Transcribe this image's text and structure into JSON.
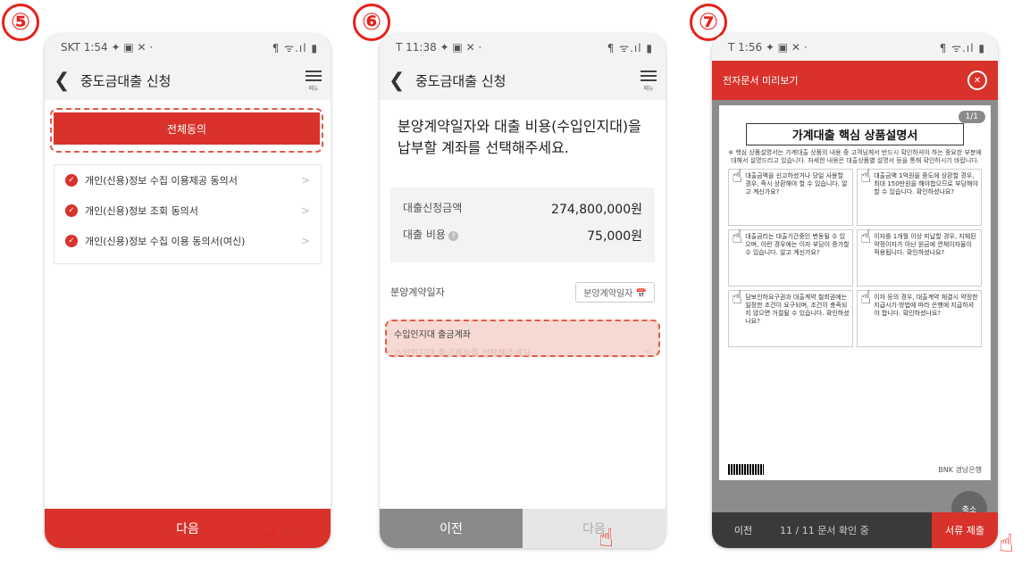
{
  "steps": {
    "s5": "⑤",
    "s6": "⑥",
    "s7": "⑦"
  },
  "phone5": {
    "status_left": "SKT 1:54 ✦ ▣ ✕ ·",
    "status_right": "¶ ᯤ.ıl ▮",
    "title": "중도금대출 신청",
    "menu_label": "메뉴",
    "agree_all": "전체동의",
    "consents": [
      "개인(신용)정보 수집 이용제공 동의서",
      "개인(신용)정보 조회 동의서",
      "개인(신용)정보 수집 이용 동의서(여신)"
    ],
    "next": "다음"
  },
  "phone6": {
    "status_left": "T 11:38 ✦ ▣ ✕ ·",
    "status_right": "¶ ᯤ.ıl ▮",
    "title": "중도금대출 신청",
    "menu_label": "메뉴",
    "heading": "분양계약일자와 대출 비용(수입인지대)을 납부할 계좌를 선택해주세요.",
    "loan_amount_label": "대출신청금액",
    "loan_amount": "274,800,000원",
    "loan_cost_label": "대출 비용",
    "loan_cost": "75,000원",
    "contract_date_label": "분양계약일자",
    "contract_date_button": "분양계약일자 📅",
    "account_label": "수입인지대 출금계좌",
    "account_placeholder": "수입인지대 출금계좌를 선택해주세요",
    "prev": "이전",
    "next": "다음"
  },
  "phone7": {
    "status_left": "T 1:56 ✦ ▣ ✕ ·",
    "status_right": "¶ ᯤ.ıl ▮",
    "header": "전자문서 미리보기",
    "pager": "1/1",
    "doc_title": "가계대출 핵심 상품설명서",
    "doc_intro": "※ 핵심 상품설명서는 가계대출 상품의 내용 중 고객님께서 반드시 확인하셔야 하는 중요한 부분에 대해서 설명드리고 있습니다. 자세한 내용은 대출상품별 설명서 등을 통해 확인하시기 바랍니다.",
    "cells": [
      "대출금액을 신고하셨거나 당일 사용할 경우, 즉시 상환해야 할 수 있습니다. 알고 계신가요?",
      "대출금액 1억원을 중도에 상환할 경우, 최대 150만원을 해야합으므로 부담해야 할 수 있습니다. 확인하셨나요?",
      "대출금리는 대출기간중인 변동될 수 있으며, 이런 경우에는 이자 부담이 증가할 수 있습니다. 알고 계신가요?",
      "이자를 1개월 이상 미납할 경우, 지체된 약정이자가 아닌 원금에 연체이자율이 적용됩니다. 확인하셨나요?",
      "담보인하요구권과 대출계약 철회권에는 일정한 조건이 요구되며, 조건이 충족되지 않으면 거절될 수 있습니다. 확인하셨나요?",
      "이자 등의 경우, 대출계약 체결시 약정한 지급시기·방법에 따라 은행에 지급하셔야 합니다. 확인하셨나요?"
    ],
    "footer_brand": "BNK 경남은행",
    "zoom": "축소",
    "prev": "이전",
    "page_status": "11 / 11 문서 확인 중",
    "submit": "서류 제출"
  }
}
